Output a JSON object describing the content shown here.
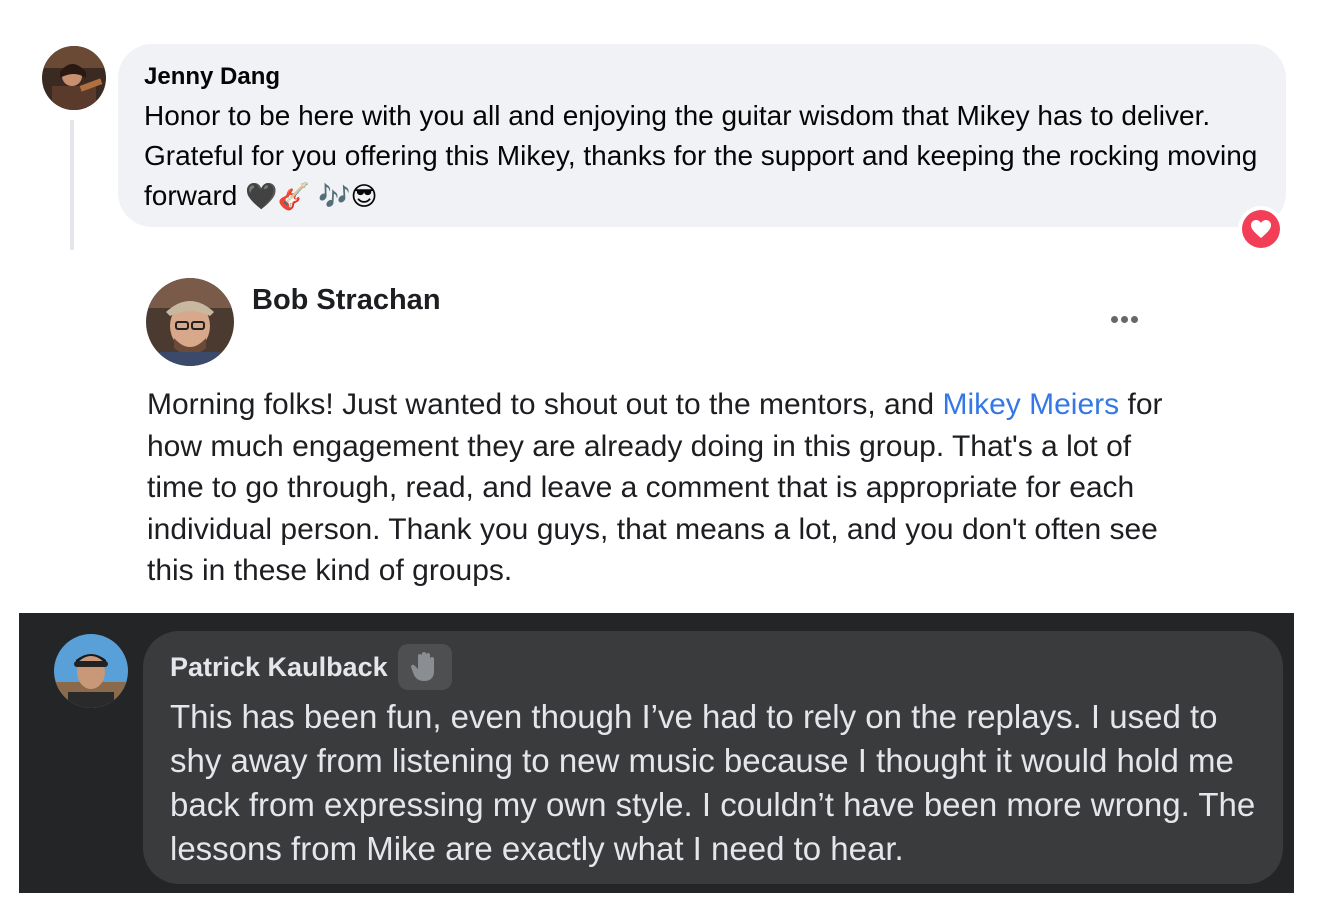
{
  "comment1": {
    "author": "Jenny Dang",
    "text": "Honor to be here with you all and enjoying the guitar wisdom that Mikey has to deliver. Grateful for you offering this Mikey, thanks for the support and keeping the rocking moving forward",
    "emojis": "🖤🎸 🎶😎",
    "reaction": "love",
    "reaction_color": "#f33e58"
  },
  "post": {
    "author": "Bob Strachan",
    "text_before": "Morning folks! Just wanted to shout out to the mentors, and ",
    "mention": "Mikey Meiers",
    "text_after": " for how much engagement they are already doing in this group. That's a lot of time to go through, read, and leave a comment that is appropriate for each individual person. Thank you guys, that means a lot,  and you don't often see this in these kind of groups.",
    "more_icon": "more-options-icon",
    "mention_color": "#3578e5"
  },
  "comment2": {
    "author": "Patrick Kaulback",
    "badge_icon": "waving-hand-icon",
    "text": "This has been fun, even though I’ve had to rely on the replays. I used to shy away from listening to new music because I thought it would hold me back from expressing my own style. I couldn’t have been more wrong. The lessons from Mike are exactly what I need to hear.",
    "theme": "dark"
  }
}
